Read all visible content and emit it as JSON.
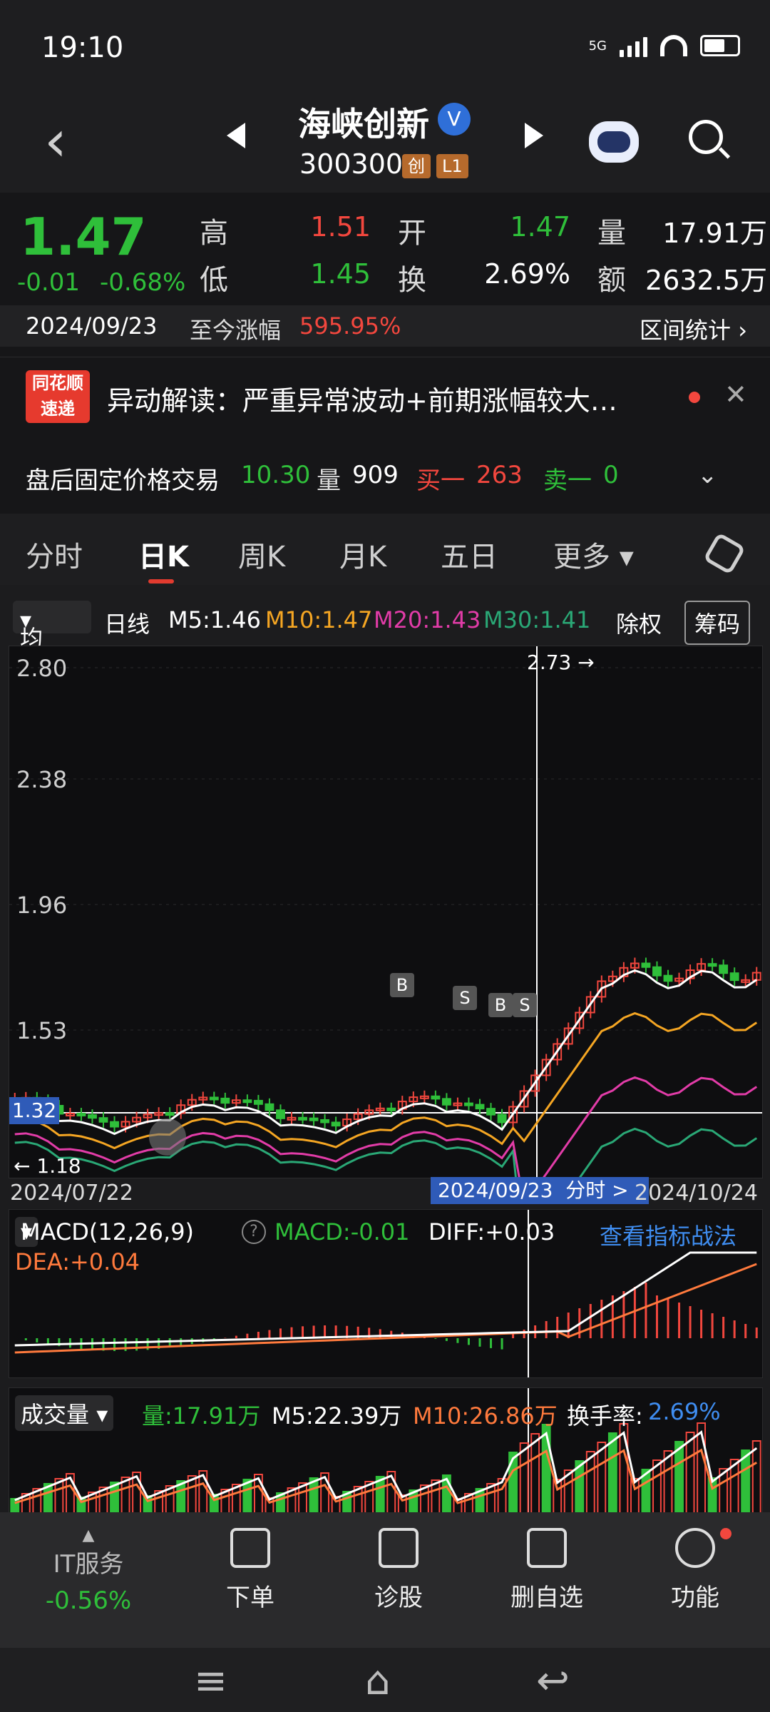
{
  "status_bar": {
    "time": "19:10",
    "network": "5G"
  },
  "header": {
    "stock_name": "海峡创新",
    "verified_mark": "V",
    "code": "300300",
    "tags": [
      "创",
      "L1"
    ]
  },
  "quote": {
    "price": "1.47",
    "change": "-0.01",
    "change_pct": "-0.68%",
    "high_label": "高",
    "high": "1.51",
    "low_label": "低",
    "low": "1.45",
    "open_label": "开",
    "open": "1.47",
    "turnover_label": "换",
    "turnover": "2.69%",
    "volume_label": "量",
    "volume": "17.91万",
    "amount_label": "额",
    "amount": "2632.5万",
    "date": "2024/09/23",
    "since_label": "至今涨幅",
    "since_value": "595.95%",
    "range_stats": "区间统计"
  },
  "news": {
    "logo_line1": "同花顺",
    "logo_line2": "速递",
    "text": "异动解读：严重异常波动+前期涨幅较大…"
  },
  "after_hours": {
    "label": "盘后固定价格交易",
    "price": "10.30",
    "vol_label": "量",
    "vol": "909",
    "buy_label": "买一",
    "buy": "263",
    "sell_label": "卖一",
    "sell": "0"
  },
  "tabs": [
    "分时",
    "日K",
    "周K",
    "月K",
    "五日",
    "更多"
  ],
  "active_tab": "日K",
  "ma_bar": {
    "selector": "均线",
    "period": "日线",
    "m5": "M5:1.46",
    "m10": "M10:1.47",
    "m20": "M20:1.43",
    "m30": "M30:1.41",
    "adjust": "除权",
    "chips": "筹码"
  },
  "chart": {
    "y_labels": [
      "2.80",
      "2.38",
      "1.96",
      "1.53"
    ],
    "current_price_label": "1.32",
    "high_mark": "2.73",
    "low_mark": "1.18",
    "start_date": "2024/07/22",
    "cursor_date": "2024/09/23",
    "cursor_link": "分时",
    "end_date": "2024/10/24",
    "markers": [
      "B",
      "S",
      "B",
      "S"
    ]
  },
  "macd": {
    "selector": "MACD(12,26,9)",
    "macd": "MACD:-0.01",
    "diff": "DIFF:+0.03",
    "dea": "DEA:+0.04",
    "link": "查看指标战法"
  },
  "volume_panel": {
    "selector": "成交量",
    "vol": "量:17.91万",
    "m5": "M5:22.39万",
    "m10": "M10:26.86万",
    "turnover_label": "换手率:",
    "turnover": "2.69%"
  },
  "bottom_nav": {
    "sector": "IT服务",
    "sector_change": "-0.56%",
    "items": [
      "下单",
      "诊股",
      "删自选",
      "功能"
    ]
  },
  "colors": {
    "up": "#f2473e",
    "down": "#2fbf3a",
    "ma5": "#ffffff",
    "ma10": "#f5a623",
    "ma20": "#e23ca8",
    "ma30": "#2aa876"
  }
}
